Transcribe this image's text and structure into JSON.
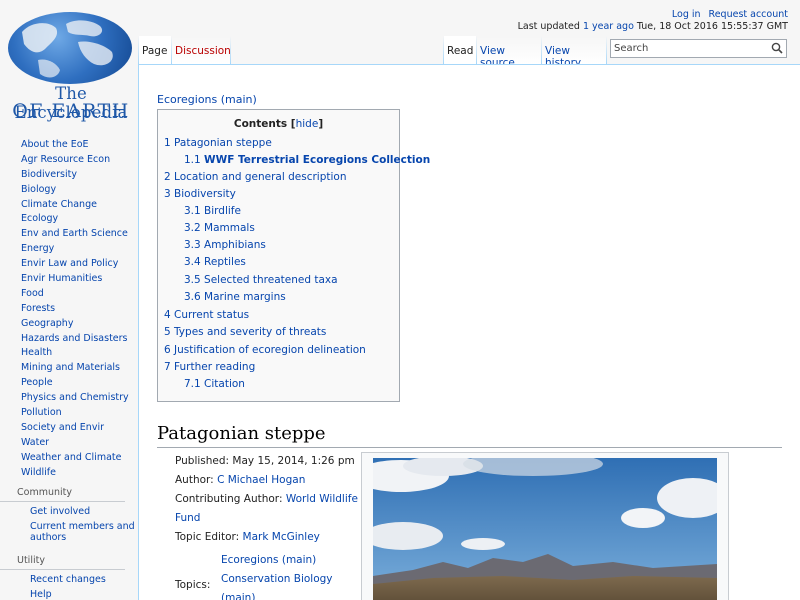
{
  "logo": {
    "line1": "The Encyclopedia",
    "line2": "OF EARTH"
  },
  "personal": {
    "login": "Log in",
    "request": "Request account",
    "last_updated_prefix": "Last updated",
    "last_updated_ago": "1 year ago",
    "last_updated_date": "Tue, 18 Oct 2016 15:55:37 GMT"
  },
  "tabs": {
    "page": "Page",
    "discussion": "Discussion",
    "read": "Read",
    "view_source": "View source",
    "view_history": "View history"
  },
  "search": {
    "placeholder": "Search"
  },
  "sidebar": {
    "nav": [
      "About the EoE",
      "Agr Resource Econ",
      "Biodiversity",
      "Biology",
      "Climate Change",
      "Ecology",
      "Env and Earth Science",
      "Energy",
      "Envir Law and Policy",
      "Envir Humanities",
      "Food",
      "Forests",
      "Geography",
      "Hazards and Disasters",
      "Health",
      "Mining and Materials",
      "People",
      "Physics and Chemistry",
      "Pollution",
      "Society and Envir",
      "Water",
      "Weather and Climate",
      "Wildlife"
    ],
    "community_heading": "Community",
    "community": [
      "Get involved",
      "Current members and authors"
    ],
    "utility_heading": "Utility",
    "utility": [
      "Recent changes",
      "Help"
    ]
  },
  "content": {
    "breadcrumb": "Ecoregions (main)",
    "toc": {
      "title": "Contents",
      "hide": "hide",
      "items": [
        {
          "num": "1",
          "text": "Patagonian steppe",
          "level": 1
        },
        {
          "num": "1.1",
          "text": "WWF Terrestrial Ecoregions Collection",
          "level": 2,
          "bold": true
        },
        {
          "num": "2",
          "text": "Location and general description",
          "level": 1
        },
        {
          "num": "3",
          "text": "Biodiversity",
          "level": 1
        },
        {
          "num": "3.1",
          "text": "Birdlife",
          "level": 2
        },
        {
          "num": "3.2",
          "text": "Mammals",
          "level": 2
        },
        {
          "num": "3.3",
          "text": "Amphibians",
          "level": 2
        },
        {
          "num": "3.4",
          "text": "Reptiles",
          "level": 2
        },
        {
          "num": "3.5",
          "text": "Selected threatened taxa",
          "level": 2
        },
        {
          "num": "3.6",
          "text": "Marine margins",
          "level": 2
        },
        {
          "num": "4",
          "text": "Current status",
          "level": 1
        },
        {
          "num": "5",
          "text": "Types and severity of threats",
          "level": 1
        },
        {
          "num": "6",
          "text": "Justification of ecoregion delineation",
          "level": 1
        },
        {
          "num": "7",
          "text": "Further reading",
          "level": 1
        },
        {
          "num": "7.1",
          "text": "Citation",
          "level": 2
        }
      ]
    },
    "section_heading": "Patagonian steppe",
    "info": {
      "published": "Published: May 15, 2014, 1:26 pm",
      "author_label": "Author:",
      "author": "C Michael Hogan",
      "contrib_label": "Contributing Author:",
      "contrib_line1": "World Wildlife",
      "contrib_line2": "Fund",
      "editor_label": "Topic Editor:",
      "editor": "Mark McGinley",
      "topics_label": "Topics:",
      "topics": [
        "Ecoregions (main)",
        "Conservation Biology",
        "(main)"
      ]
    }
  }
}
